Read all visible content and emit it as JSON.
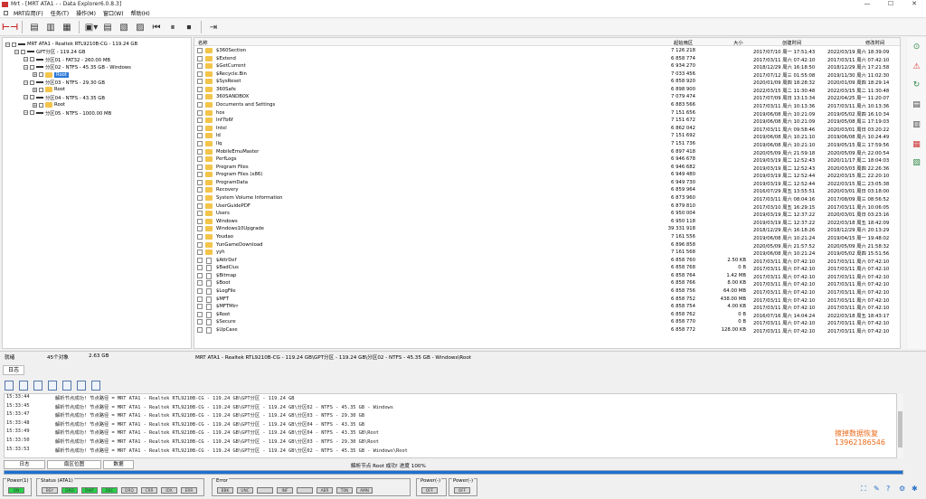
{
  "window": {
    "title": "Mrt - [MRT ATA1 - - Data Explorer6.0.8.3]",
    "controls": [
      "—",
      "☐",
      "✕"
    ]
  },
  "menu": [
    "MRT应用(F)",
    "任务(T)",
    "操作(M)",
    "窗口(W)",
    "帮助(H)"
  ],
  "tree": [
    {
      "label": "MRT ATA1 - Realtek RTL9210B-CG - 119.24 GB",
      "indent": 0,
      "kind": "disk"
    },
    {
      "label": "GPT分区 - 119.24 GB",
      "indent": 1,
      "kind": "part"
    },
    {
      "label": "分区01 - FAT32 - 260.00 MB",
      "indent": 2,
      "kind": "part"
    },
    {
      "label": "分区02 - NTFS - 45.35 GB - Windows",
      "indent": 2,
      "kind": "part"
    },
    {
      "label": "Root",
      "indent": 3,
      "kind": "folder",
      "selected": true
    },
    {
      "label": "分区03 - NTFS - 29.30 GB",
      "indent": 2,
      "kind": "part"
    },
    {
      "label": "Root",
      "indent": 3,
      "kind": "folder"
    },
    {
      "label": "分区04 - NTFS - 43.35 GB",
      "indent": 2,
      "kind": "part"
    },
    {
      "label": "Root",
      "indent": 3,
      "kind": "folder"
    },
    {
      "label": "分区05 - NTFS - 1000.00 MB",
      "indent": 2,
      "kind": "part"
    }
  ],
  "files": {
    "headers": {
      "name": "名称",
      "sector": "起始扇区",
      "size": "大小",
      "created": "创建时间",
      "modified": "修改时间"
    },
    "rows": [
      {
        "n": "$360Section",
        "s": "7 126 218",
        "z": "",
        "c": "2017/07/10 周一 17:51:43",
        "m": "2022/03/19 周六 18:39:09",
        "t": "folder"
      },
      {
        "n": "$Extend",
        "s": "6 858 774",
        "z": "",
        "c": "2017/03/11 周六 07:42:10",
        "m": "2017/03/11 周六 07:42:10",
        "t": "folder"
      },
      {
        "n": "$GetCurrent",
        "s": "6 934 270",
        "z": "",
        "c": "2018/12/29 周六 16:18:50",
        "m": "2018/12/29 周六 17:21:58",
        "t": "folder"
      },
      {
        "n": "$Recycle.Bin",
        "s": "7 033 456",
        "z": "",
        "c": "2017/07/12 周三 01:55:08",
        "m": "2019/11/30 周六 11:02:30",
        "t": "folder"
      },
      {
        "n": "$SysReset",
        "s": "6 858 920",
        "z": "",
        "c": "2020/01/09 周四 18:28:32",
        "m": "2020/01/09 周四 18:29:14",
        "t": "folder"
      },
      {
        "n": "360Safe",
        "s": "6 898 900",
        "z": "",
        "c": "2022/03/15 周二 11:30:48",
        "m": "2022/03/15 周二 11:30:48",
        "t": "folder"
      },
      {
        "n": "360SANDBOX",
        "s": "7 079 474",
        "z": "",
        "c": "2017/07/09 周日 13:13:34",
        "m": "2022/04/25 周一 11:20:07",
        "t": "folder"
      },
      {
        "n": "Documents and Settings",
        "s": "6 883 566",
        "z": "",
        "c": "2017/03/11 周六 10:13:36",
        "m": "2017/03/11 周六 10:13:36",
        "t": "folder"
      },
      {
        "n": "hos",
        "s": "7 151 656",
        "z": "",
        "c": "2019/06/08 周六 10:21:09",
        "m": "2019/05/02 周四 16:10:34",
        "t": "folder"
      },
      {
        "n": "Inf7b6f",
        "s": "7 151 672",
        "z": "",
        "c": "2019/06/08 周六 10:21:09",
        "m": "2019/05/08 周三 17:19:03",
        "t": "folder"
      },
      {
        "n": "Intel",
        "s": "6 862 042",
        "z": "",
        "c": "2017/03/11 周六 09:58:46",
        "m": "2020/03/01 周日 03:20:22",
        "t": "folder"
      },
      {
        "n": "Id",
        "s": "7 151 692",
        "z": "",
        "c": "2019/06/08 周六 10:21:10",
        "m": "2019/06/08 周六 10:24:49",
        "t": "folder"
      },
      {
        "n": "llq",
        "s": "7 151 736",
        "z": "",
        "c": "2019/06/08 周六 10:21:10",
        "m": "2019/05/15 周三 17:59:56",
        "t": "folder"
      },
      {
        "n": "MobileEmuMaster",
        "s": "6 897 418",
        "z": "",
        "c": "2020/05/09 周六 21:59:18",
        "m": "2020/05/09 周六 22:00:54",
        "t": "folder"
      },
      {
        "n": "PerfLogs",
        "s": "6 946 678",
        "z": "",
        "c": "2019/03/19 周二 12:52:43",
        "m": "2020/11/17 周二 18:04:03",
        "t": "folder"
      },
      {
        "n": "Program Files",
        "s": "6 946 682",
        "z": "",
        "c": "2019/03/19 周二 12:52:43",
        "m": "2020/03/03 周四 22:26:36",
        "t": "folder"
      },
      {
        "n": "Program Files (x86)",
        "s": "6 949 480",
        "z": "",
        "c": "2019/03/19 周二 12:52:44",
        "m": "2022/03/15 周二 22:20:10",
        "t": "folder"
      },
      {
        "n": "ProgramData",
        "s": "6 949 730",
        "z": "",
        "c": "2019/03/19 周二 12:52:44",
        "m": "2022/03/15 周二 23:05:38",
        "t": "folder"
      },
      {
        "n": "Recovery",
        "s": "6 859 964",
        "z": "",
        "c": "2016/07/29 周五 13:55:51",
        "m": "2020/03/01 周日 03:18:00",
        "t": "folder"
      },
      {
        "n": "System Volume Information",
        "s": "6 873 960",
        "z": "",
        "c": "2017/03/11 周六 08:04:16",
        "m": "2017/08/09 周三 08:56:52",
        "t": "folder"
      },
      {
        "n": "UserGuidePDF",
        "s": "6 879 810",
        "z": "",
        "c": "2017/03/10 周五 16:29:15",
        "m": "2017/03/11 周六 10:06:05",
        "t": "folder"
      },
      {
        "n": "Users",
        "s": "6 950 004",
        "z": "",
        "c": "2019/03/19 周二 12:37:22",
        "m": "2020/03/01 周日 03:23:16",
        "t": "folder"
      },
      {
        "n": "Windows",
        "s": "6 950 118",
        "z": "",
        "c": "2019/03/19 周二 12:37:22",
        "m": "2022/03/18 周五 18:42:09",
        "t": "folder"
      },
      {
        "n": "Windows10Upgrade",
        "s": "39 331 918",
        "z": "",
        "c": "2018/12/29 周六 16:18:26",
        "m": "2018/12/29 周六 20:13:29",
        "t": "folder"
      },
      {
        "n": "Youdao",
        "s": "7 161 556",
        "z": "",
        "c": "2019/06/08 周六 10:21:24",
        "m": "2019/04/15 周一 19:48:02",
        "t": "folder"
      },
      {
        "n": "YunGameDownload",
        "s": "6 896 858",
        "z": "",
        "c": "2020/05/09 周六 21:57:52",
        "m": "2020/05/09 周六 21:58:32",
        "t": "folder"
      },
      {
        "n": "yyh",
        "s": "7 161 568",
        "z": "",
        "c": "2019/06/08 周六 10:21:24",
        "m": "2019/05/02 周四 15:51:56",
        "t": "folder"
      },
      {
        "n": "$AttrDef",
        "s": "6 858 760",
        "z": "2.50 KB",
        "c": "2017/03/11 周六 07:42:10",
        "m": "2017/03/11 周六 07:42:10",
        "t": "file"
      },
      {
        "n": "$BadClus",
        "s": "6 858 768",
        "z": "0 B",
        "c": "2017/03/11 周六 07:42:10",
        "m": "2017/03/11 周六 07:42:10",
        "t": "file"
      },
      {
        "n": "$Bitmap",
        "s": "6 858 764",
        "z": "1.42 MB",
        "c": "2017/03/11 周六 07:42:10",
        "m": "2017/03/11 周六 07:42:10",
        "t": "file"
      },
      {
        "n": "$Boot",
        "s": "6 858 766",
        "z": "8.00 KB",
        "c": "2017/03/11 周六 07:42:10",
        "m": "2017/03/11 周六 07:42:10",
        "t": "file"
      },
      {
        "n": "$LogFile",
        "s": "6 858 756",
        "z": "64.00 MB",
        "c": "2017/03/11 周六 07:42:10",
        "m": "2017/03/11 周六 07:42:10",
        "t": "file"
      },
      {
        "n": "$MFT",
        "s": "6 858 752",
        "z": "438.00 MB",
        "c": "2017/03/11 周六 07:42:10",
        "m": "2017/03/11 周六 07:42:10",
        "t": "file"
      },
      {
        "n": "$MFTMirr",
        "s": "6 858 754",
        "z": "4.00 KB",
        "c": "2017/03/11 周六 07:42:10",
        "m": "2017/03/11 周六 07:42:10",
        "t": "file"
      },
      {
        "n": "$Root",
        "s": "6 858 762",
        "z": "0 B",
        "c": "2016/07/16 周六 14:04:24",
        "m": "2022/03/18 周五 18:43:17",
        "t": "file"
      },
      {
        "n": "$Secure",
        "s": "6 858 770",
        "z": "0 B",
        "c": "2017/03/11 周六 07:42:10",
        "m": "2017/03/11 周六 07:42:10",
        "t": "file"
      },
      {
        "n": "$UpCase",
        "s": "6 858 772",
        "z": "128.00 KB",
        "c": "2017/03/11 周六 07:42:10",
        "m": "2017/03/11 周六 07:42:10",
        "t": "file"
      }
    ]
  },
  "status": {
    "state": "就绪",
    "count": "45个对象",
    "size": "2.63 GB",
    "path": "MRT ATA1 - Realtek RTL9210B-CG - 119.24 GB\\GPT分区 - 119.24 GB\\分区02 - NTFS - 45.35 GB - Windows\\Root"
  },
  "log": {
    "tab": "日志",
    "rows": [
      {
        "t": "15:33:44",
        "m": "解析节点成功! 节点路径 = MRT ATA1 - Realtek RTL9210B-CG - 119.24 GB\\GPT分区 - 119.24 GB"
      },
      {
        "t": "15:33:45",
        "m": "解析节点成功! 节点路径 = MRT ATA1 - Realtek RTL9210B-CG - 119.24 GB\\GPT分区 - 119.24 GB\\分区02 - NTFS - 45.35 GB - Windows"
      },
      {
        "t": "15:33:47",
        "m": "解析节点成功! 节点路径 = MRT ATA1 - Realtek RTL9210B-CG - 119.24 GB\\GPT分区 - 119.24 GB\\分区03 - NTFS - 29.30 GB"
      },
      {
        "t": "15:33:48",
        "m": "解析节点成功! 节点路径 = MRT ATA1 - Realtek RTL9210B-CG - 119.24 GB\\GPT分区 - 119.24 GB\\分区04 - NTFS - 43.35 GB"
      },
      {
        "t": "15:33:49",
        "m": "解析节点成功! 节点路径 = MRT ATA1 - Realtek RTL9210B-CG - 119.24 GB\\GPT分区 - 119.24 GB\\分区04 - NTFS - 43.35 GB\\Root"
      },
      {
        "t": "15:33:50",
        "m": "解析节点成功! 节点路径 = MRT ATA1 - Realtek RTL9210B-CG - 119.24 GB\\GPT分区 - 119.24 GB\\分区03 - NTFS - 29.30 GB\\Root"
      },
      {
        "t": "15:33:53",
        "m": "解析节点成功! 节点路径 = MRT ATA1 - Realtek RTL9210B-CG - 119.24 GB\\GPT分区 - 119.24 GB\\分区02 - NTFS - 45.35 GB - Windows\\Root"
      }
    ],
    "watermark1": "擦掉数据恢复",
    "watermark2": "13962186546"
  },
  "bottom": {
    "tabs": [
      "日志",
      "扇区位图",
      "数据"
    ],
    "message": "解析节点 Root 成功!  进度 100%",
    "progress": 1.0
  },
  "panel": {
    "groups": [
      {
        "title": "Power(1)",
        "leds": [
          {
            "l": "ON",
            "on": true
          }
        ]
      },
      {
        "title": "Status (ATA1)",
        "leds": [
          {
            "l": "BSY",
            "on": false
          },
          {
            "l": "DRD",
            "on": true
          },
          {
            "l": "DWF",
            "on": true
          },
          {
            "l": "DSC",
            "on": true
          },
          {
            "l": "DRQ",
            "on": false
          },
          {
            "l": "CRR",
            "on": false
          },
          {
            "l": "IDX",
            "on": false
          },
          {
            "l": "ERR",
            "on": false
          }
        ]
      },
      {
        "title": "Error",
        "leds": [
          {
            "l": "BBK",
            "on": false
          },
          {
            "l": "UNC",
            "on": false
          },
          {
            "l": "",
            "on": false
          },
          {
            "l": "INF",
            "on": false
          },
          {
            "l": "",
            "on": false
          },
          {
            "l": "ABR",
            "on": false
          },
          {
            "l": "T0N",
            "on": false
          },
          {
            "l": "AMN",
            "on": false
          }
        ]
      },
      {
        "title": "Power(-)",
        "leds": [
          {
            "l": "OFF",
            "on": false
          }
        ]
      },
      {
        "title": "Power(-)",
        "leds": [
          {
            "l": "OFF",
            "on": false
          }
        ]
      }
    ]
  },
  "colors": {
    "accent": "#1f6fd0",
    "led_on": "#29d24a",
    "folder": "#f3c44a",
    "watermark": "#e96a1a"
  }
}
